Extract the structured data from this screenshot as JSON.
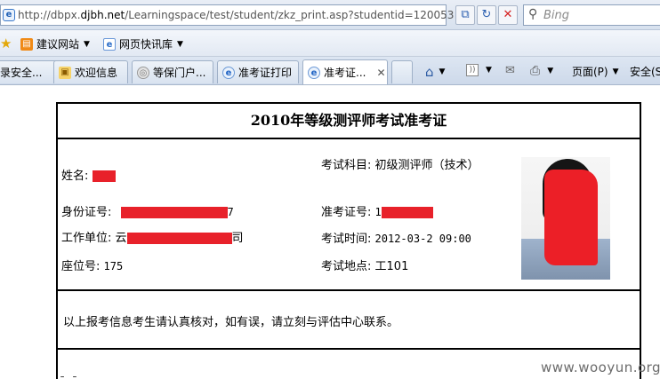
{
  "browser": {
    "address_prefix": "http://dbpx.",
    "address_domain": "djbh.net",
    "address_path": "/Learningspace/test/student/zkz_print.asp?studentid=120053",
    "search_placeholder": "Bing",
    "icons": {
      "page": "ie-page-icon",
      "compat": "compatibility-view-icon",
      "refresh": "refresh-icon",
      "stop": "stop-icon",
      "search": "search-icon"
    }
  },
  "favorites": {
    "items": [
      {
        "label": "建议网站",
        "icon": "suggested-sites-icon"
      },
      {
        "label": "网页快讯库",
        "icon": "web-slice-gallery-icon"
      }
    ]
  },
  "tabs": [
    {
      "label": "录安全...",
      "icon": "ie-icon",
      "active": false
    },
    {
      "label": "欢迎信息",
      "icon": "lock-icon",
      "active": false
    },
    {
      "label": "等保门户...",
      "icon": "shield-icon",
      "active": false
    },
    {
      "label": "准考证打印",
      "icon": "ie-icon",
      "active": false
    },
    {
      "label": "准考证...",
      "icon": "ie-icon",
      "active": true
    }
  ],
  "command_bar": {
    "page_label": "页面(P)",
    "safety_label": "安全(S"
  },
  "ticket": {
    "title": "2010年等级测评师考试准考证",
    "name_label": "姓名:",
    "id_label": "身份证号:",
    "id_tail": "7",
    "work_label": "工作单位:",
    "work_head": "云",
    "work_tail": "司",
    "seat_label": "座位号:",
    "seat_value": "175",
    "subject_label": "考试科目:",
    "subject_value": "初级测评师（技术）",
    "exam_no_label": "准考证号:",
    "exam_no_head": "1",
    "time_label": "考试时间:",
    "time_value": "2012-03-2 09:00",
    "place_label": "考试地点:",
    "place_value": "工101",
    "notice": "以上报考信息考生请认真核对，如有误，请立刻与评估中心联系。",
    "below_text": "ﾃ   ﾃ"
  },
  "watermark": "www.wooyun.org",
  "colors": {
    "redaction": "#e8212a",
    "chrome_bg": "#dde6f2"
  }
}
